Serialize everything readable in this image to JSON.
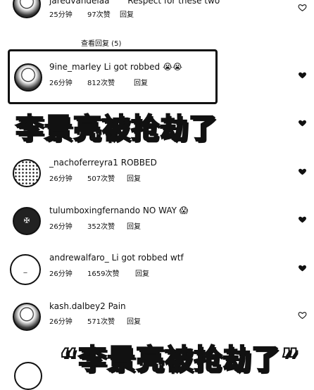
{
  "top_comment": {
    "username": "jaredvandeiaa",
    "text": "Respect for these two",
    "time": "25分钟",
    "likes": "97次赞",
    "reply": "回复"
  },
  "view_more_replies": "查看回复 (5)",
  "comments": [
    {
      "username": "9ine_marley",
      "text": "Li got robbed",
      "emoji": "😭😭",
      "time": "26分钟",
      "likes": "812次赞",
      "reply": "回复"
    },
    {
      "username": "_nachoferreyra1",
      "text": "ROBBED",
      "emoji": "",
      "time": "26分钟",
      "likes": "507次赞",
      "reply": "回复"
    },
    {
      "username": "tulumboxingfernando",
      "text": "NO WAY",
      "emoji": "😱",
      "time": "26分钟",
      "likes": "352次赞",
      "reply": "回复"
    },
    {
      "username": "andrewalfaro_",
      "text": "Li got robbed wtf",
      "emoji": "",
      "time": "26分钟",
      "likes": "1659次赞",
      "reply": "回复"
    },
    {
      "username": "kash.dalbey2",
      "text": "Pain",
      "emoji": "",
      "time": "26分钟",
      "likes": "571次赞",
      "reply": "回复"
    }
  ],
  "captions": {
    "overlay_1": "李景亮被抢劫了",
    "overlay_2": "“李景亮被抢劫了”"
  },
  "icons": {
    "like": "heart-icon"
  }
}
